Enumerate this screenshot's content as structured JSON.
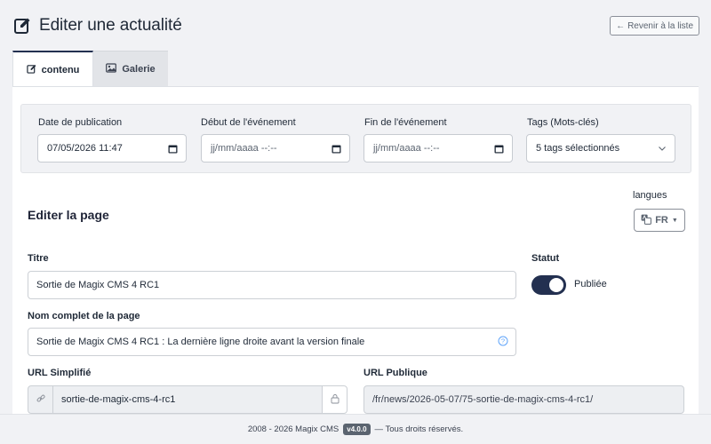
{
  "header": {
    "title": "Editer une actualité",
    "back_button": "Revenir à la liste"
  },
  "tabs": [
    {
      "label": "contenu",
      "icon": "edit-icon",
      "active": true
    },
    {
      "label": "Galerie",
      "icon": "image-icon",
      "active": false
    }
  ],
  "meta": {
    "publication_date": {
      "label": "Date de publication",
      "value": "07/05/2026 11:47"
    },
    "event_start": {
      "label": "Début de l'événement",
      "value": "jj/mm/aaaa --:--"
    },
    "event_end": {
      "label": "Fin de l'événement",
      "value": "jj/mm/aaaa --:--"
    },
    "tags": {
      "label": "Tags (Mots-clés)",
      "value": "5 tags sélectionnés"
    }
  },
  "section": {
    "title": "Editer la page",
    "languages_label": "langues",
    "language": "FR"
  },
  "form": {
    "title_label": "Titre",
    "title_value": "Sortie de Magix CMS 4 RC1",
    "status_label": "Statut",
    "status_value": "Publiée",
    "status_on": true,
    "full_name_label": "Nom complet de la page",
    "full_name_value": "Sortie de Magix CMS 4 RC1 : La dernière ligne droite avant la version finale",
    "url_simplified_label": "URL Simplifié",
    "url_simplified_value": "sortie-de-magix-cms-4-rc1",
    "url_public_label": "URL Publique",
    "url_public_value": "/fr/news/2026-05-07/75-sortie-de-magix-cms-4-rc1/"
  },
  "footer": {
    "copyright": "2008 - 2026 Magix CMS",
    "version": "v4.0.0",
    "rights": "— Tous droits réservés."
  },
  "colors": {
    "accent": "#233050",
    "background": "#f1f2f5",
    "card": "#ffffff"
  }
}
